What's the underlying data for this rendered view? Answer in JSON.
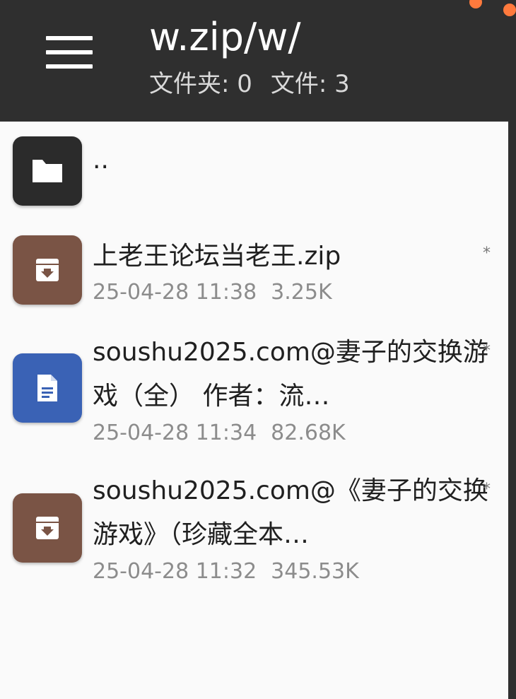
{
  "toolbar": {
    "title": "w.zip/w/",
    "folders_label": "文件夹: 0",
    "files_label": "文件: 3"
  },
  "colors": {
    "toolbar_bg": "#2f2f2f",
    "folder_icon_bg": "#2b2b2b",
    "archive_icon_bg": "#7a5445",
    "document_icon_bg": "#3a62b5",
    "accent_dot": "#ff7a3d"
  },
  "items": [
    {
      "name": "..",
      "icon": "folder-icon",
      "date": "",
      "size": "",
      "star": ""
    },
    {
      "name": "上老王论坛当老王.zip",
      "icon": "archive-icon",
      "date": "25-04-28 11:38",
      "size": "3.25K",
      "star": "*"
    },
    {
      "name": "soushu2025.com@妻子的交换游戏（全） 作者：流…",
      "icon": "document-icon",
      "date": "25-04-28 11:34",
      "size": "82.68K",
      "star": "*"
    },
    {
      "name": "soushu2025.com@《妻子的交换游戏》（珍藏全本…",
      "icon": "archive-icon",
      "date": "25-04-28 11:32",
      "size": "345.53K",
      "star": "*"
    }
  ]
}
